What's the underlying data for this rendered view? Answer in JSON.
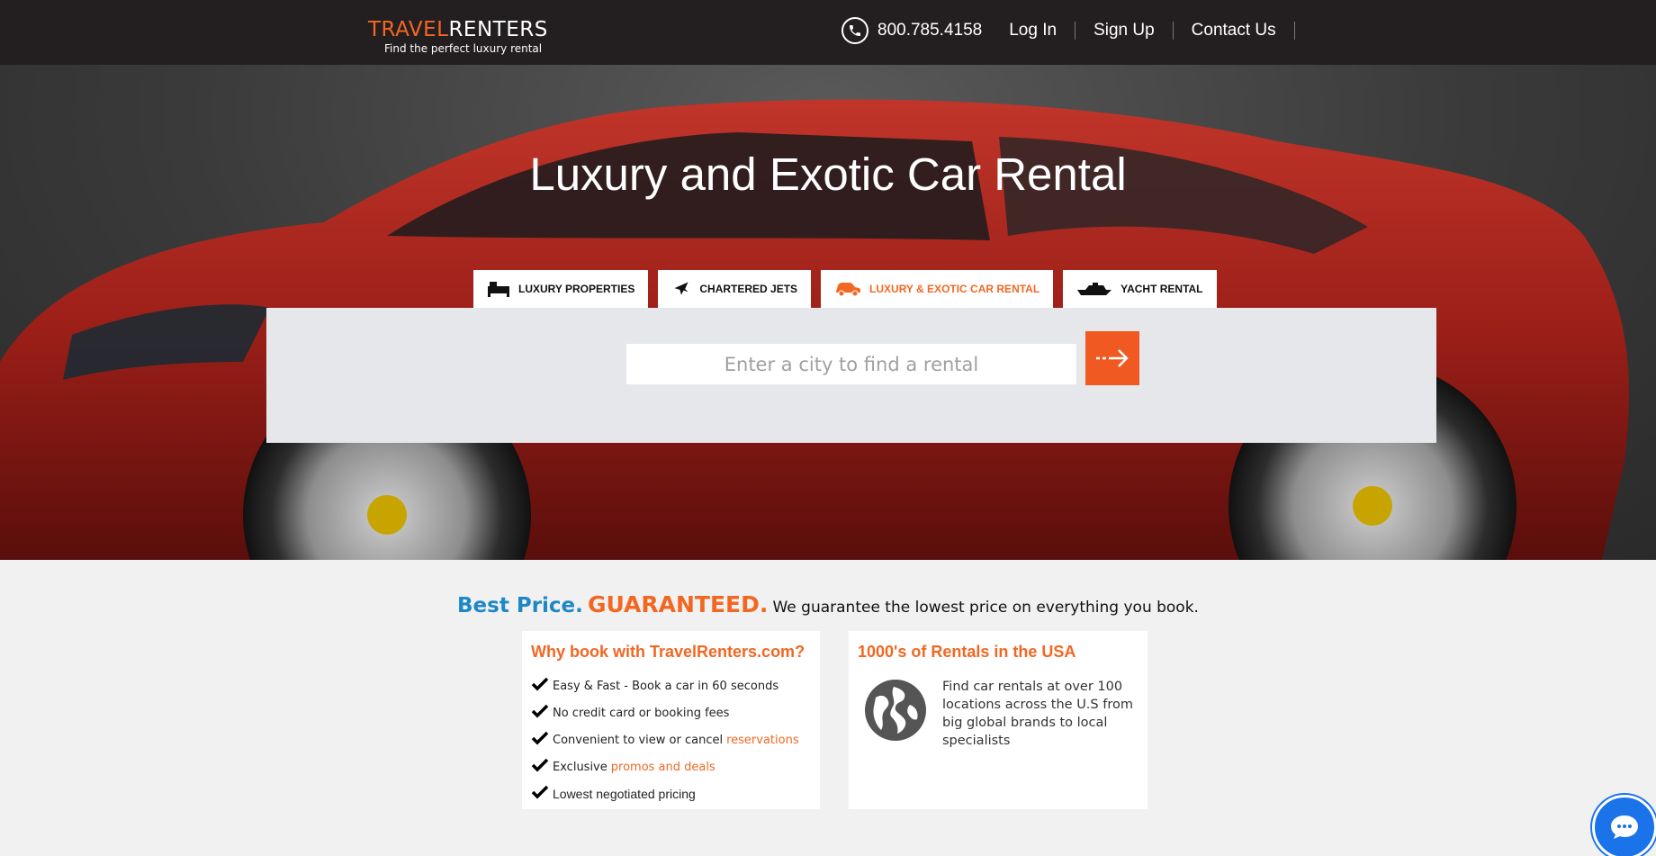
{
  "header": {
    "logo_part1": "TRAVEL",
    "logo_part2": "RENTERS",
    "tagline": "Find the perfect luxury rental",
    "phone": "800.785.4158",
    "links": [
      "Log In",
      "Sign Up",
      "Contact Us"
    ]
  },
  "hero": {
    "title": "Luxury and Exotic Car Rental",
    "tabs": [
      {
        "label": "LUXURY PROPERTIES",
        "icon": "bed-icon"
      },
      {
        "label": "CHARTERED JETS",
        "icon": "plane-icon"
      },
      {
        "label": "LUXURY & EXOTIC CAR RENTAL",
        "icon": "car-icon",
        "active": true
      },
      {
        "label": "YACHT RENTAL",
        "icon": "yacht-icon"
      }
    ],
    "search_placeholder": "Enter a city to find a rental"
  },
  "guarantee": {
    "part1": "Best Price.",
    "part2": "GUARANTEED.",
    "part3": "We guarantee the lowest price on everything you book."
  },
  "why_card": {
    "title": "Why book with TravelRenters.com?",
    "items": [
      {
        "text": "Easy & Fast - Book a car in 60 seconds",
        "link": ""
      },
      {
        "text": "No credit card or booking fees",
        "link": ""
      },
      {
        "text": "Convenient to view or cancel",
        "link": "reservations"
      },
      {
        "text": "Exclusive",
        "link": "promos and deals"
      },
      {
        "text": "Lowest negotiated pricing",
        "link": ""
      }
    ]
  },
  "rentals_card": {
    "title": "1000's of Rentals in the USA",
    "text": "Find car rentals at over 100 locations across the U.S from big global brands to local specialists"
  },
  "colors": {
    "accent": "#f26722",
    "blue": "#1e88c7",
    "topbar": "#231f20"
  }
}
